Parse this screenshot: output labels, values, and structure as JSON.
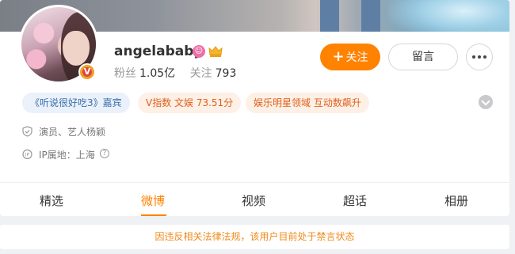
{
  "profile": {
    "name": "angelababy",
    "verified_badge": "V",
    "level_icon": "pink-level-icon",
    "crown_icon": "gold-crown-icon",
    "fans_label": "粉丝",
    "fans_value": "1.05亿",
    "following_label": "关注",
    "following_value": "793"
  },
  "actions": {
    "follow_plus": "+",
    "follow_label": "关注",
    "message_label": "留言",
    "more_icon": "more-dots-icon"
  },
  "tags": [
    {
      "label": "《听说很好吃3》嘉宾"
    },
    {
      "label": "V指数 文娱 73.51分"
    },
    {
      "label": "娱乐明星领域 互动数飙升"
    }
  ],
  "info": {
    "identity": "演员、艺人杨颖",
    "ip_location": "IP属地：上海",
    "help_glyph": "?"
  },
  "tabs": [
    {
      "label": "精选"
    },
    {
      "label": "微博"
    },
    {
      "label": "视频"
    },
    {
      "label": "超话"
    },
    {
      "label": "相册"
    }
  ],
  "notice": "因违反相关法律法规，该用户目前处于禁言状态",
  "colors": {
    "accent": "#ff8200",
    "tag_blue_text": "#3b6ea8",
    "tag_orange_text": "#e0601b",
    "notice_text": "#f08a1a"
  }
}
